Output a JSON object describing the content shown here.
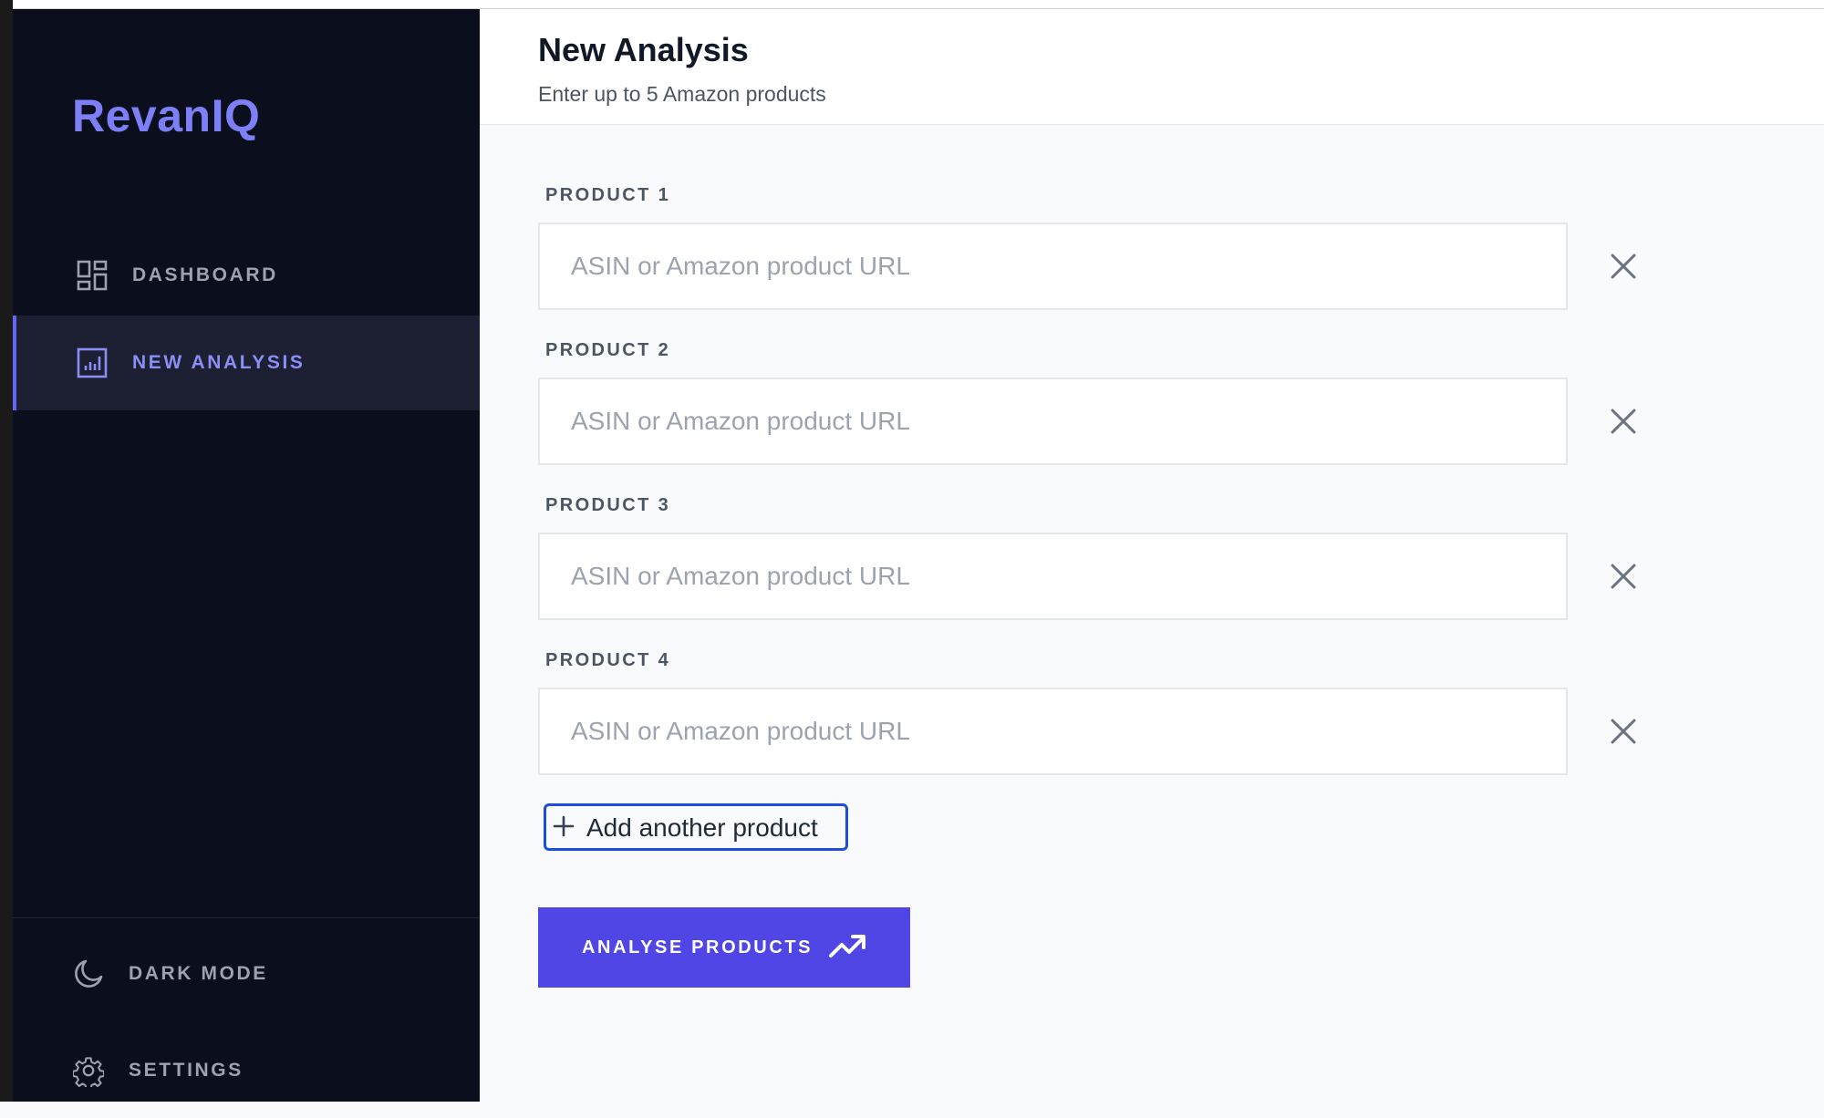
{
  "brand": {
    "name": "RevanIQ",
    "color": "#7c7ff6"
  },
  "sidebar": {
    "items": [
      {
        "label": "DASHBOARD",
        "icon": "dashboard-grid-icon",
        "active": false
      },
      {
        "label": "NEW ANALYSIS",
        "icon": "bar-chart-square-icon",
        "active": true
      }
    ],
    "footer": [
      {
        "label": "DARK MODE",
        "icon": "moon-icon"
      },
      {
        "label": "SETTINGS",
        "icon": "gear-icon"
      }
    ]
  },
  "header": {
    "title": "New Analysis",
    "subtitle": "Enter up to 5 Amazon products"
  },
  "form": {
    "products": [
      {
        "label": "PRODUCT 1",
        "value": "",
        "placeholder": "ASIN or Amazon product URL"
      },
      {
        "label": "PRODUCT 2",
        "value": "",
        "placeholder": "ASIN or Amazon product URL"
      },
      {
        "label": "PRODUCT 3",
        "value": "",
        "placeholder": "ASIN or Amazon product URL"
      },
      {
        "label": "PRODUCT 4",
        "value": "",
        "placeholder": "ASIN or Amazon product URL"
      }
    ],
    "add_label": "Add another product",
    "submit_label": "ANALYSE PRODUCTS"
  },
  "colors": {
    "accent": "#4f46e5",
    "sidebar_bg": "#0b0e1c",
    "active_nav_bg": "#1c2032",
    "focus_ring": "#1d4ed8"
  }
}
